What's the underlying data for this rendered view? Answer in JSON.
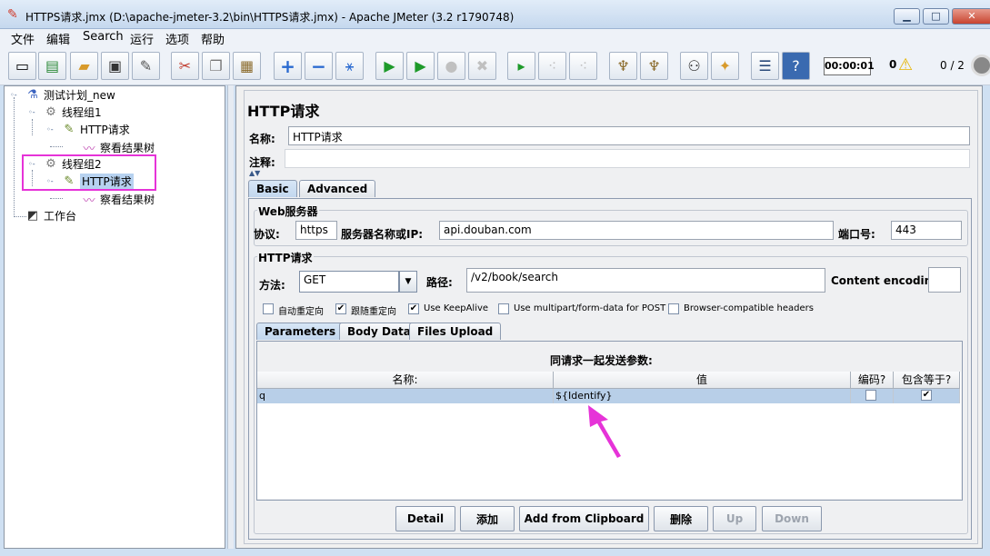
{
  "window": {
    "title": "HTTPS请求.jmx (D:\\apache-jmeter-3.2\\bin\\HTTPS请求.jmx) - Apache JMeter (3.2 r1790748)",
    "minimize": "▁",
    "maximize": "□",
    "close": "✕"
  },
  "menu": [
    "文件",
    "编辑",
    "Search",
    "运行",
    "选项",
    "帮助"
  ],
  "toolbar": {
    "timer": "00:00:01",
    "error_count": "0",
    "threads": "0 / 2"
  },
  "tree": {
    "root": "测试计划_new",
    "group1": "线程组1",
    "group1_http": "HTTP请求",
    "group1_listener": "察看结果树",
    "group2": "线程组2",
    "group2_http": "HTTP请求",
    "group2_listener": "察看结果树",
    "workbench": "工作台"
  },
  "panel": {
    "title": "HTTP请求",
    "name_label": "名称:",
    "name_value": "HTTP请求",
    "comment_label": "注释:",
    "comment_value": "",
    "tabs": [
      "Basic",
      "Advanced"
    ],
    "web_server_group": "Web服务器",
    "protocol_label": "协议:",
    "protocol_value": "https",
    "server_label": "服务器名称或IP:",
    "server_value": "api.douban.com",
    "port_label": "端口号:",
    "port_value": "443",
    "http_request_group": "HTTP请求",
    "method_label": "方法:",
    "method_value": "GET",
    "path_label": "路径:",
    "path_value": "/v2/book/search",
    "encoding_label": "Content encoding:",
    "encoding_value": "",
    "checkboxes": [
      {
        "label": "自动重定向",
        "checked": false
      },
      {
        "label": "跟随重定向",
        "checked": true
      },
      {
        "label": "Use KeepAlive",
        "checked": true
      },
      {
        "label": "Use multipart/form-data for POST",
        "checked": false
      },
      {
        "label": "Browser-compatible headers",
        "checked": false
      }
    ],
    "sub_tabs": [
      "Parameters",
      "Body Data",
      "Files Upload"
    ],
    "params_caption": "同请求一起发送参数:",
    "columns": [
      "名称:",
      "值",
      "编码?",
      "包含等于?"
    ],
    "rows": [
      {
        "name": "q",
        "value": "${Identify}",
        "encode": false,
        "include_equals": true
      }
    ],
    "buttons": [
      "Detail",
      "添加",
      "Add from Clipboard",
      "删除",
      "Up",
      "Down"
    ]
  }
}
